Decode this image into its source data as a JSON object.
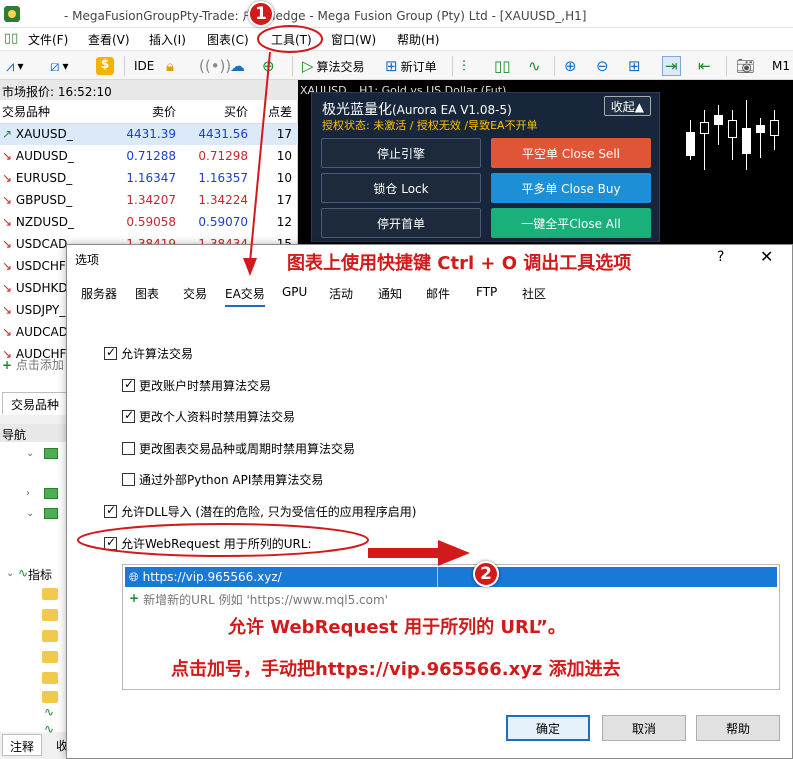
{
  "window": {
    "title": "- MegaFusionGroupPty-Trade: 户 - Hedge - Mega Fusion Group (Pty) Ltd - [XAUUSD_,H1]"
  },
  "menu": [
    "文件(F)",
    "查看(V)",
    "插入(I)",
    "图表(C)",
    "工具(T)",
    "窗口(W)",
    "帮助(H)"
  ],
  "toolbar": {
    "ide": "IDE",
    "algo_trading": "算法交易",
    "new_order": "新订单",
    "mt_label": "M1"
  },
  "market_watch": {
    "time_label": "市场报价: 16:52:10",
    "columns": [
      "交易品种",
      "卖价",
      "买价",
      "点差"
    ],
    "rows": [
      {
        "symbol": "XAUUSD_",
        "dir": "up",
        "bid": "4431.39",
        "ask": "4431.56",
        "spread": "17"
      },
      {
        "symbol": "AUDUSD_",
        "dir": "down",
        "bid": "0.71288",
        "ask": "0.71298",
        "spread": "10"
      },
      {
        "symbol": "EURUSD_",
        "dir": "down",
        "bid": "1.16347",
        "ask": "1.16357",
        "spread": "10"
      },
      {
        "symbol": "GBPUSD_",
        "dir": "down",
        "bid": "1.34207",
        "ask": "1.34224",
        "spread": "17"
      },
      {
        "symbol": "NZDUSD_",
        "dir": "down",
        "bid": "0.59058",
        "ask": "0.59070",
        "spread": "12"
      },
      {
        "symbol": "USDCAD",
        "dir": "down",
        "bid": "1.38419",
        "ask": "1.38434",
        "spread": "15"
      },
      {
        "symbol": "USDCHF",
        "dir": "down",
        "bid": "",
        "ask": "",
        "spread": ""
      },
      {
        "symbol": "USDHKD",
        "dir": "down",
        "bid": "",
        "ask": "",
        "spread": ""
      },
      {
        "symbol": "USDJPY_",
        "dir": "down",
        "bid": "",
        "ask": "",
        "spread": ""
      },
      {
        "symbol": "AUDCAD",
        "dir": "down",
        "bid": "",
        "ask": "",
        "spread": ""
      },
      {
        "symbol": "AUDCHF",
        "dir": "down",
        "bid": "",
        "ask": "",
        "spread": ""
      }
    ],
    "add_symbol": "点击添加",
    "tab_symbols": "交易品种"
  },
  "navigator": {
    "title": "导航",
    "indicators_label": "指标",
    "bottom_tab": "注释",
    "bottom_tab2": "收"
  },
  "chart": {
    "header": "XAUUSD_, H1: Gold vs US Dollar (Fut)"
  },
  "ea_panel": {
    "title": "极光蓝量化",
    "version": "(Aurora EA V1.08-5)",
    "status": "授权状态: 未激活 / 授权无效 /导致EA不开单",
    "collapse": "收起▲",
    "btn_stop": "停止引擎",
    "btn_close_sell": "平空单 Close Sell",
    "btn_lock": "锁仓 Lock",
    "btn_close_buy": "平多单 Close Buy",
    "btn_pause_first": "停开首单",
    "btn_close_all": "一键全平Close All"
  },
  "dialog": {
    "title": "选项",
    "help": "?",
    "close": "✕",
    "annotation_top": "图表上使用快捷键 Ctrl + O 调出工具选项",
    "tabs": [
      "服务器",
      "图表",
      "交易",
      "EA交易",
      "GPU",
      "活动",
      "通知",
      "邮件",
      "FTP",
      "社区"
    ],
    "active_tab": "EA交易",
    "options": [
      {
        "label": "允许算法交易",
        "checked": true
      },
      {
        "label": "更改账户时禁用算法交易",
        "checked": true
      },
      {
        "label": "更改个人资料时禁用算法交易",
        "checked": true
      },
      {
        "label": "更改图表交易品种或周期时禁用算法交易",
        "checked": false
      },
      {
        "label": "通过外部Python API禁用算法交易",
        "checked": false
      },
      {
        "label": "允许DLL导入 (潜在的危险, 只为受信任的应用程序启用)",
        "checked": true
      },
      {
        "label": "允许WebRequest 用于所列的URL:",
        "checked": true
      }
    ],
    "url_list": {
      "url": "https://vip.965566.xyz/",
      "add_hint": "新增新的URL 例如 'https://www.mql5.com'"
    },
    "annotation_mid": "允许 WebRequest 用于所列的 URL”。",
    "annotation_bottom": "点击加号，手动把https://vip.965566.xyz 添加进去",
    "buttons": {
      "ok": "确定",
      "cancel": "取消",
      "help": "帮助"
    }
  },
  "badges": {
    "one": "1",
    "two": "2"
  },
  "colors": {
    "annotation_red": "#d21a1a",
    "selection_blue": "#1a78d6",
    "ea_panel_bg": "#17263a"
  }
}
